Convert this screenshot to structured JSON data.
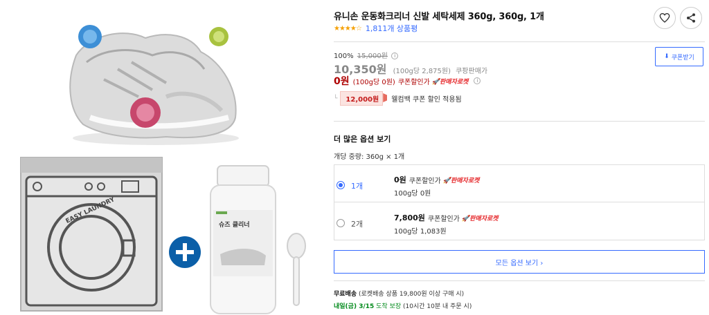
{
  "product": {
    "title": "유니손 운동화크리너 신발 세탁세제 360g, 360g, 1개",
    "stars": "★★★★☆",
    "review_count": "1,811개 상품평",
    "rating": 4.5
  },
  "price": {
    "discount_rate": "100%",
    "original_price": "15,000원",
    "sale_price": "10,350원",
    "sale_unit": "(100g당 2,875원)",
    "sale_label": "쿠팡판매가",
    "coupon_price": "0원",
    "coupon_unit": "(100g당 0원)",
    "coupon_label": "쿠폰할인가",
    "rocket_label": "판매자로켓",
    "cashback_amount": "12,000원",
    "cashback_text": "웰컴백 쿠폰 할인 적용됨",
    "coupon_button": "쿠폰받기"
  },
  "options": {
    "title": "더 많은 옵션 보기",
    "subtitle": "개당 중량: 360g × 1개",
    "items": [
      {
        "qty": "1개",
        "price": "0원",
        "price_label": "쿠폰할인가",
        "rocket": "판매자로켓",
        "unit": "100g당 0원",
        "selected": true
      },
      {
        "qty": "2개",
        "price": "7,800원",
        "price_label": "쿠폰할인가",
        "rocket": "판매자로켓",
        "unit": "100g당 1,083원",
        "selected": false
      }
    ],
    "all_button": "모든 옵션 보기 ›"
  },
  "shipping": {
    "free_label": "무료배송",
    "free_detail": "(로켓배송 상품 19,800원 이상 구매 시)",
    "arrival_label": "내일(금) 3/15",
    "arrival_word": "도착 보장",
    "arrival_detail": "(10시간 10분 내 주문 시)"
  },
  "images": {
    "bag_text": "EASY LAUNDRY",
    "bottle_text": "슈즈 클리너"
  },
  "colors": {
    "accent_blue": "#346aff",
    "price_red": "#ae0000",
    "rocket_red": "#e52528",
    "arrival_green": "#00891a",
    "star_orange": "#f5a000"
  }
}
